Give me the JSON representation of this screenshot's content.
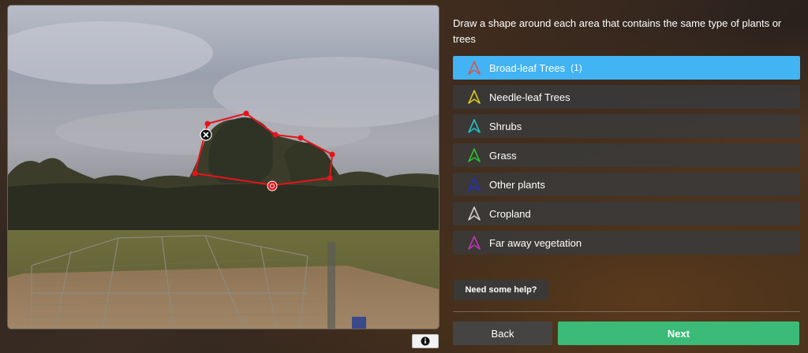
{
  "instruction": "Draw a shape around each area that contains the same type of plants or trees",
  "classes": [
    {
      "label": "Broad-leaf Trees",
      "count": "(1)",
      "color": "#d9534f",
      "selected": true
    },
    {
      "label": "Needle-leaf Trees",
      "count": "",
      "color": "#d8c81e",
      "selected": false
    },
    {
      "label": "Shrubs",
      "count": "",
      "color": "#1fc1c6",
      "selected": false
    },
    {
      "label": "Grass",
      "count": "",
      "color": "#2fc02f",
      "selected": false
    },
    {
      "label": "Other plants",
      "count": "",
      "color": "#2233bb",
      "selected": false
    },
    {
      "label": "Cropland",
      "count": "",
      "color": "#cfcfcf",
      "selected": false
    },
    {
      "label": "Far away vegetation",
      "count": "",
      "color": "#c034b0",
      "selected": false
    }
  ],
  "help_label": "Need some help?",
  "back_label": "Back",
  "next_label": "Next",
  "info_icon": "info-icon",
  "polygon_color": "#e8131a",
  "accent_color": "#42b3f3",
  "next_color": "#3cba77"
}
